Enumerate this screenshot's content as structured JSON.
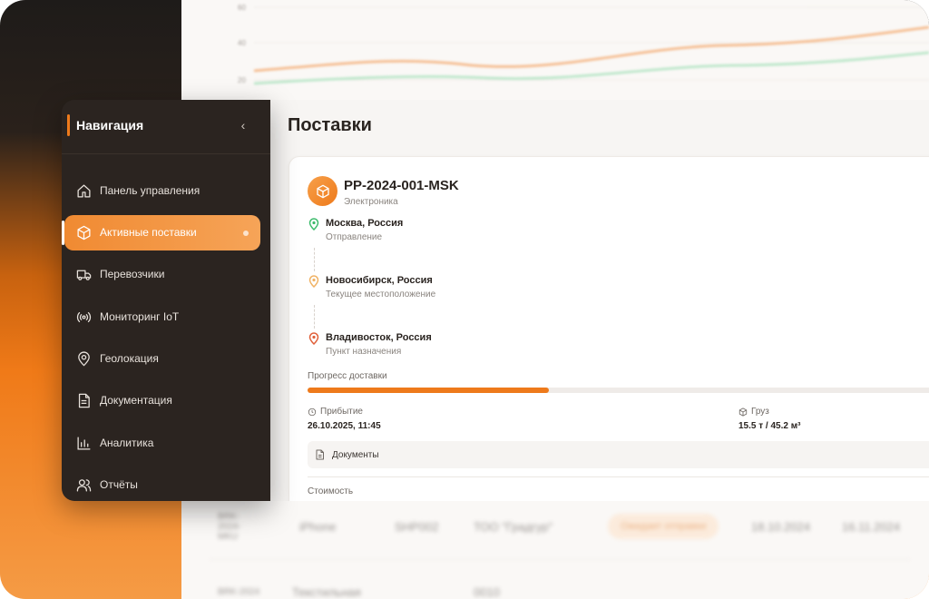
{
  "colors": {
    "accent": "#ee7a1b",
    "sidebar_bg": "#2b2420",
    "text_dark": "#2a2420",
    "muted": "#8a847f",
    "pin_green": "#3dbb6c",
    "pin_orange": "#f0b264",
    "pin_red": "#e0603a"
  },
  "sidebar": {
    "title": "Навигация",
    "collapse_icon": "chevron-left-icon",
    "items": [
      {
        "label": "Панель управления",
        "icon": "home-icon",
        "active": false
      },
      {
        "label": "Активные поставки",
        "icon": "package-icon",
        "active": true
      },
      {
        "label": "Перевозчики",
        "icon": "truck-icon",
        "active": false
      },
      {
        "label": "Мониторинг IoT",
        "icon": "radio-signal-icon",
        "active": false
      },
      {
        "label": "Геолокация",
        "icon": "map-pin-icon",
        "active": false
      },
      {
        "label": "Документация",
        "icon": "document-icon",
        "active": false
      },
      {
        "label": "Аналитика",
        "icon": "bar-chart-icon",
        "active": false
      },
      {
        "label": "Отчёты",
        "icon": "users-icon",
        "active": false
      }
    ]
  },
  "main": {
    "page_title": "Поставки",
    "shipment": {
      "id": "PP-2024-001-MSK",
      "category": "Электроника",
      "route": [
        {
          "city": "Москва, Россия",
          "note": "Отправление",
          "pin": "green"
        },
        {
          "city": "Новосибирск, Россия",
          "note": "Текущее местоположение",
          "pin": "orange"
        },
        {
          "city": "Владивосток, Россия",
          "note": "Пункт назначения",
          "pin": "red"
        }
      ],
      "progress_label": "Прогресс доставки",
      "progress": 0.38,
      "arrival_label": "Прибытие",
      "arrival_value": "26.10.2025, 11:45",
      "cargo_label": "Груз",
      "cargo_value": "15.5 т / 45.2 м³",
      "documents_label": "Документы",
      "cost_label": "Стоимость"
    }
  },
  "background": {
    "chart_ticks": [
      "60",
      "40",
      "20"
    ],
    "rows": [
      {
        "date_id": "BRK-2024-MKU",
        "type": "iPhone",
        "code": "SHP002",
        "company": "ТОО \"Градгур\"",
        "status": "Ожидает отправки",
        "date1": "18.10.2024",
        "date2": "16.11.2024"
      },
      {
        "date_id": "BRK-2024",
        "type": "Текстильная",
        "code": "0010",
        "company": "",
        "status": "",
        "date1": "",
        "date2": ""
      }
    ]
  }
}
